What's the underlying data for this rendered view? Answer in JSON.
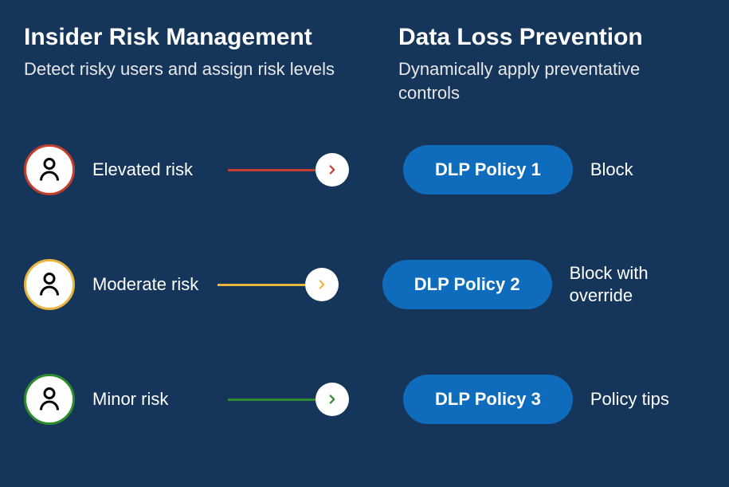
{
  "header": {
    "left": {
      "title": "Insider Risk Management",
      "subtitle": "Detect risky users and assign risk levels"
    },
    "right": {
      "title": "Data Loss Prevention",
      "subtitle": "Dynamically apply preventative controls"
    }
  },
  "rows": [
    {
      "risk_label": "Elevated risk",
      "color": "#c43e2e",
      "policy": "DLP Policy 1",
      "action": "Block"
    },
    {
      "risk_label": "Moderate risk",
      "color": "#e8b63e",
      "policy": "DLP Policy 2",
      "action": "Block with override"
    },
    {
      "risk_label": "Minor risk",
      "color": "#2e8b2e",
      "policy": "DLP Policy 3",
      "action": "Policy tips"
    }
  ]
}
